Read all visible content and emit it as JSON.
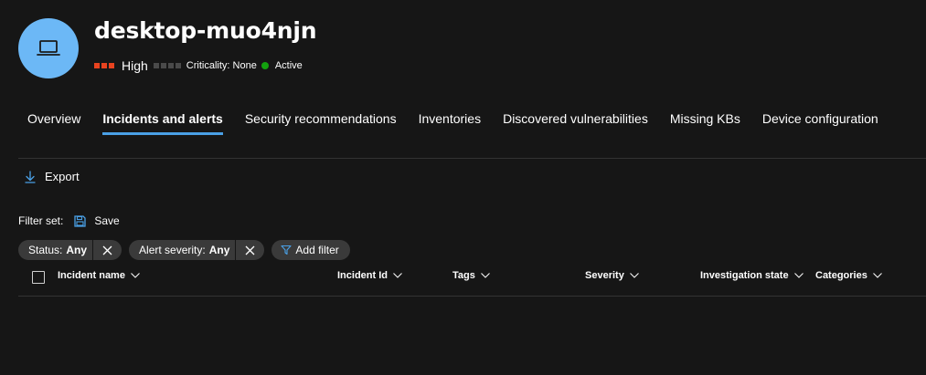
{
  "device": {
    "name": "desktop-muo4njn",
    "risk_level": "High",
    "criticality": "Criticality: None",
    "status": "Active",
    "icon": "laptop-icon"
  },
  "colors": {
    "risk_active": "#e8431f",
    "risk_inactive": "#4a4a4a",
    "status_active": "#13a10e",
    "accent": "#4aa0e6",
    "avatar": "#6cb8f6"
  },
  "tabs": [
    {
      "label": "Overview"
    },
    {
      "label": "Incidents and alerts"
    },
    {
      "label": "Security recommendations"
    },
    {
      "label": "Inventories"
    },
    {
      "label": "Discovered vulnerabilities"
    },
    {
      "label": "Missing KBs"
    },
    {
      "label": "Device configuration"
    }
  ],
  "active_tab": "Incidents and alerts",
  "toolbar": {
    "export_label": "Export"
  },
  "filter_set": {
    "label": "Filter set:",
    "save_label": "Save"
  },
  "filters": [
    {
      "name": "Status:",
      "value": "Any"
    },
    {
      "name": "Alert severity:",
      "value": "Any"
    }
  ],
  "add_filter_label": "Add filter",
  "table": {
    "columns": [
      {
        "label": "Incident name"
      },
      {
        "label": "Incident Id"
      },
      {
        "label": "Tags"
      },
      {
        "label": "Severity"
      },
      {
        "label": "Investigation state"
      },
      {
        "label": "Categories"
      }
    ],
    "rows": []
  }
}
